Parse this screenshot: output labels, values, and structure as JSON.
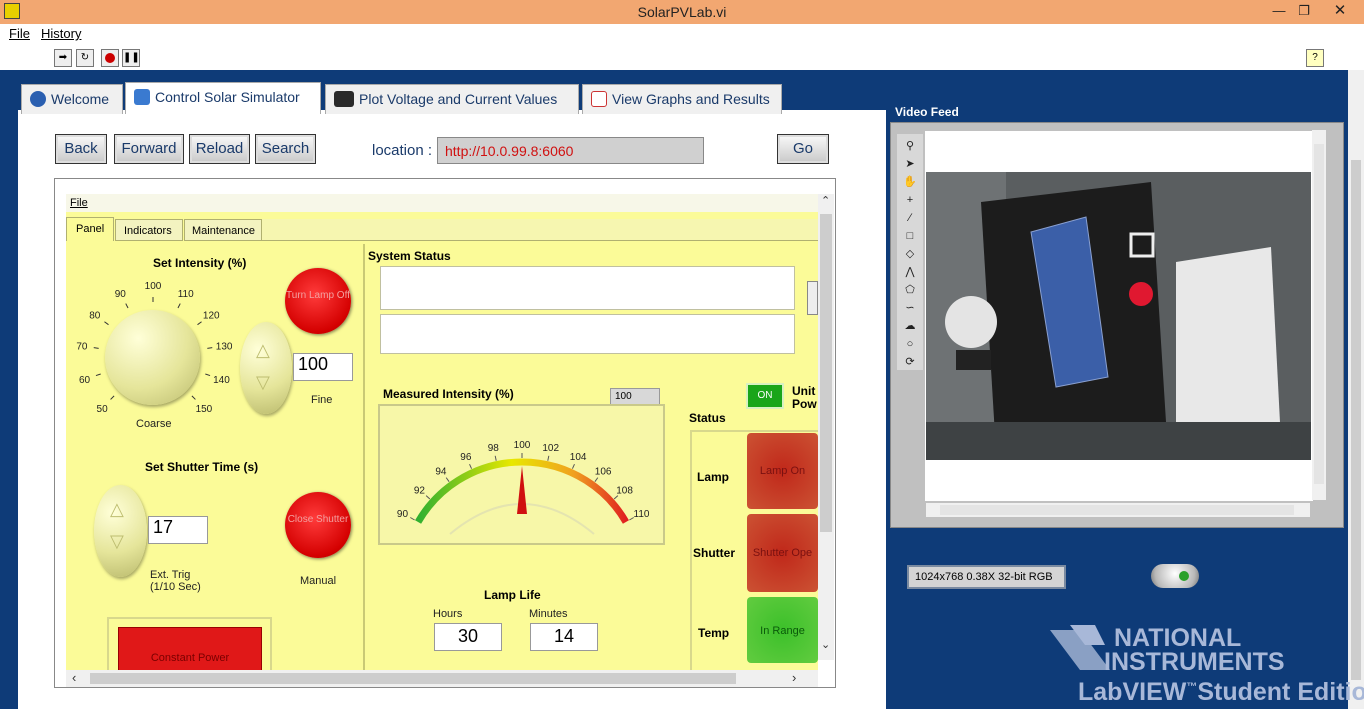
{
  "window": {
    "title": "SolarPVLab.vi"
  },
  "menu": {
    "file": "File",
    "history": "History"
  },
  "tabs": [
    {
      "label": "Welcome"
    },
    {
      "label": "Control Solar Simulator"
    },
    {
      "label": "Plot Voltage and Current Values"
    },
    {
      "label": "View Graphs and Results"
    }
  ],
  "browser": {
    "back": "Back",
    "forward": "Forward",
    "reload": "Reload",
    "search": "Search",
    "location_label": "location :",
    "location_value": "http://10.0.99.8:6060",
    "go": "Go"
  },
  "inner": {
    "file_menu": "File",
    "tabs": [
      "Panel",
      "Indicators",
      "Maintenance"
    ],
    "set_intensity_title": "Set Intensity (%)",
    "dial_ticks": [
      "50",
      "60",
      "70",
      "80",
      "90",
      "100",
      "110",
      "120",
      "130",
      "140",
      "150"
    ],
    "coarse_label": "Coarse",
    "fine_label": "Fine",
    "intensity_value": "100",
    "turn_lamp_off": "Turn Lamp Off",
    "shutter_title": "Set Shutter Time (s)",
    "shutter_value": "17",
    "ext_trig_label": "Ext. Trig",
    "ext_trig_sub": "(1/10 Sec)",
    "close_shutter": "Close Shutter",
    "manual_label": "Manual",
    "constant_power": "Constant Power",
    "system_status_title": "System Status",
    "measured_intensity_title": "Measured Intensity (%)",
    "measured_value": "100",
    "gauge_ticks": [
      "90",
      "92",
      "94",
      "96",
      "98",
      "100",
      "102",
      "104",
      "106",
      "108",
      "110"
    ],
    "gauge_needle": 100,
    "lamp_life_title": "Lamp Life",
    "hours_label": "Hours",
    "minutes_label": "Minutes",
    "hours_value": "30",
    "minutes_value": "14",
    "on_label": "ON",
    "unit_power_label_1": "Unit",
    "unit_power_label_2": "Pow",
    "status_title": "Status",
    "status_rows": [
      {
        "label": "Lamp",
        "value": "Lamp On",
        "color": "#c0281a"
      },
      {
        "label": "Shutter",
        "value": "Shutter Ope",
        "color": "#c0281a"
      },
      {
        "label": "Temp",
        "value": "In Range",
        "color": "#3cc02a"
      }
    ]
  },
  "video": {
    "title": "Video Feed",
    "info": "1024x768 0.38X 32-bit RGB"
  },
  "branding": {
    "line1": "NATIONAL",
    "line2": "INSTRUMENTS",
    "line3": "LabVIEW",
    "line3_tm": "™",
    "line3_rest": "Student Edition"
  },
  "colors": {
    "accent_blue": "#0e3b78",
    "panel_yellow": "#fbfb98",
    "lamp_red": "#c0281a",
    "ok_green": "#3cc02a"
  }
}
